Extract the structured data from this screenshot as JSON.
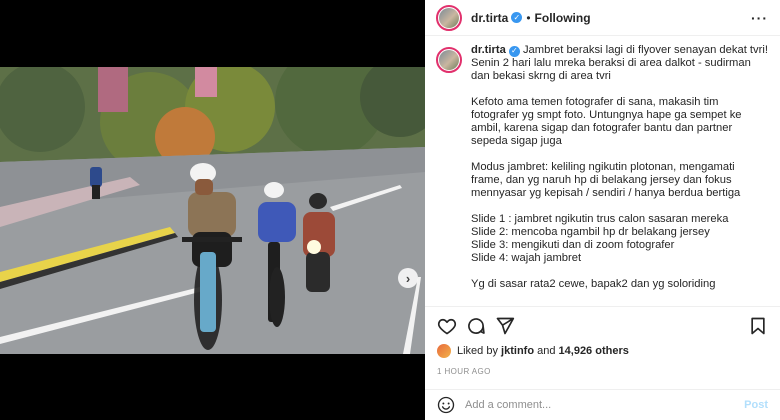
{
  "post": {
    "username": "dr.tirta",
    "follow_separator": "•",
    "follow_status": "Following",
    "more_icon": "ellipsis-icon",
    "caption": {
      "line1": "Jambret beraksi lagi di flyover senayan dekat tvri!",
      "line2": "Senin 2 hari lalu mreka beraksi di area dalkot - sudirman dan bekasi skrng di area tvri",
      "para2": "Kefoto ama temen fotografer di sana, makasih tim fotografer yg smpt foto. Untungnya hape ga sempet ke ambil, karena sigap dan fotografer bantu dan partner sepeda sigap juga",
      "para3": "Modus jambret: keliling ngikutin plotonan, mengamati frame, dan yg naruh hp di belakang jersey dan fokus mennyasar yg kepisah / sendiri / hanya berdua bertiga",
      "slides": [
        "Slide 1 : jambret ngikutin trus calon sasaran mereka",
        "Slide 2: mencoba ngambil hp dr belakang jersey",
        "Slide 3: mengikuti dan di zoom fotografer",
        "Slide 4: wajah jambret"
      ],
      "para5": "Yg di sasar rata2 cewe, bapak2 dan yg soloriding"
    },
    "likes": {
      "prefix": "Liked by",
      "user": "jktinfo",
      "joiner": "and",
      "count": "14,926 others"
    },
    "timestamp": "1 HOUR AGO",
    "comment": {
      "placeholder": "Add a comment...",
      "post_label": "Post"
    },
    "next_label": "›"
  },
  "icons": [
    "heart-icon",
    "comment-icon",
    "share-icon",
    "bookmark-icon",
    "emoji-icon",
    "verified-badge-icon"
  ],
  "colors": {
    "verified": "#3897f0",
    "post_button_disabled": "#b2dffc",
    "story_ring": "#e1306c",
    "muted": "#8e8e8e"
  }
}
